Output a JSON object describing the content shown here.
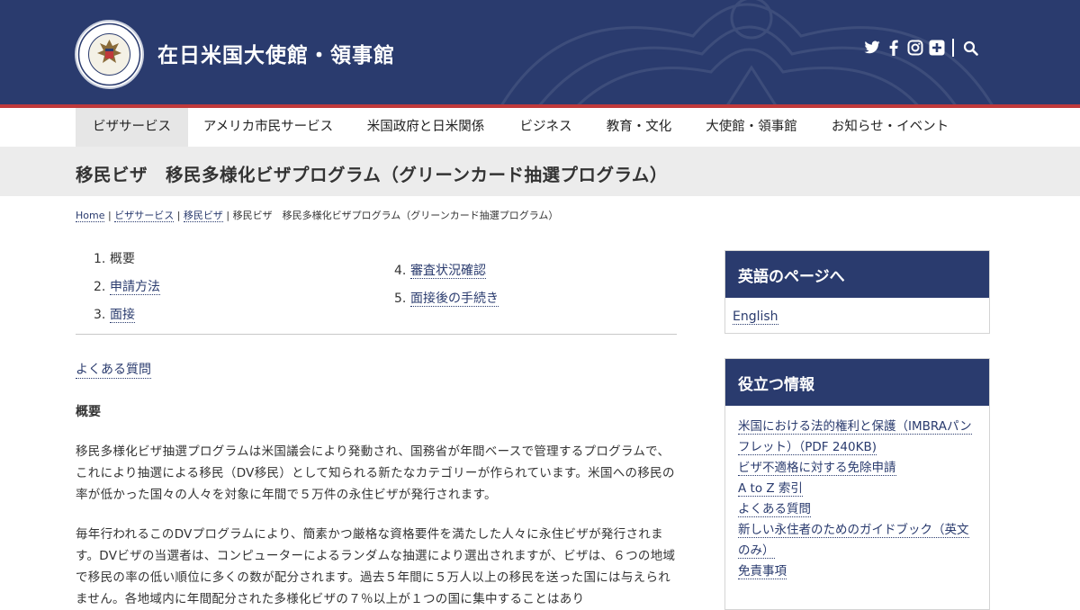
{
  "header": {
    "site_title": "在日米国大使館・領事館",
    "social_icons": [
      "twitter-icon",
      "facebook-icon",
      "instagram-icon",
      "plus-icon",
      "search-icon"
    ]
  },
  "colors": {
    "navy": "#2a3b6e",
    "red_stripe": "#c0393b",
    "band_gray": "#ececec"
  },
  "nav": {
    "items": [
      {
        "label": "ビザサービス",
        "active": true
      },
      {
        "label": "アメリカ市民サービス"
      },
      {
        "label": "米国政府と日米関係"
      },
      {
        "label": "ビジネス"
      },
      {
        "label": "教育・文化"
      },
      {
        "label": "大使館・領事館"
      },
      {
        "label": "お知らせ・イベント"
      }
    ]
  },
  "page_title": "移民ビザ　移民多様化ビザプログラム（グリーンカード抽選プログラム）",
  "breadcrumb": {
    "items": [
      "Home",
      "ビザサービス",
      "移民ビザ"
    ],
    "sep": "|",
    "current": "移民ビザ　移民多様化ビザプログラム（グリーンカード抽選プログラム）"
  },
  "toc": {
    "items": [
      {
        "num": "1.",
        "label": "概要"
      },
      {
        "num": "2.",
        "label": "申請方法"
      },
      {
        "num": "3.",
        "label": "面接"
      },
      {
        "num": "4.",
        "label": "審査状況確認"
      },
      {
        "num": "5.",
        "label": "面接後の手続き"
      }
    ]
  },
  "main": {
    "faq_link": "よくある質問",
    "section_heading": "概要",
    "paragraph1": "移民多様化ビザ抽選プログラムは米国議会により発動され、国務省が年間ベースで管理するプログラムで、これにより抽選による移民（DV移民）として知られる新たなカテゴリーが作られています。米国への移民の率が低かった国々の人々を対象に年間で５万件の永住ビザが発行されます。",
    "paragraph2": "毎年行われるこのDVプログラムにより、簡素かつ厳格な資格要件を満たした人々に永住ビザが発行されます。DVビザの当選者は、コンピューターによるランダムな抽選により選出されますが、ビザは、６つの地域で移民の率の低い順位に多くの数が配分されます。過去５年間に５万人以上の移民を送った国には与えられません。各地域内に年間配分された多様化ビザの７％以上が１つの国に集中することはあり"
  },
  "sidebar": {
    "english_box": {
      "title": "英語のページへ",
      "link": "English"
    },
    "useful_box": {
      "title": "役立つ情報",
      "items": [
        "米国における法的権利と保護（IMBRAパンフレット）（PDF 240KB)",
        "ビザ不適格に対する免除申請",
        "A to Z 索引",
        "よくある質問",
        "新しい永住者のためのガイドブック（英文のみ）",
        "免責事項"
      ]
    }
  }
}
